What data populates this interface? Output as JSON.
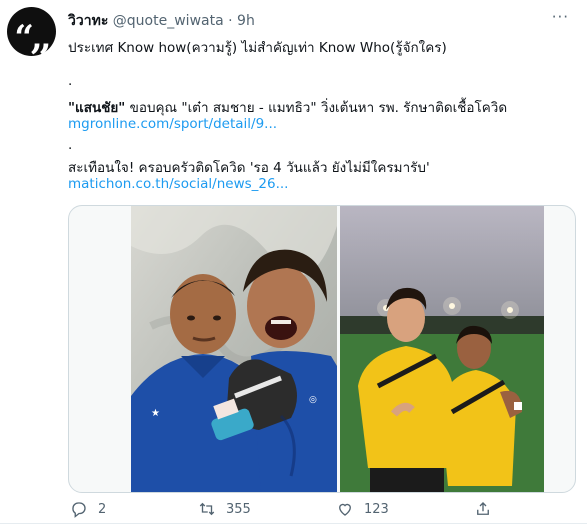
{
  "tweet": {
    "display_name": "วิวาทะ",
    "handle": "@quote_wiwata",
    "separator": "·",
    "time": "9h",
    "more_label": "···",
    "avatar_glyph": "“,,",
    "line1": "ประเทศ Know how(ความรู้) ไม่สำคัญเท่า Know Who(รู้จักใคร)",
    "dot1": ".",
    "line2_bold": "\"แสนชัย\"",
    "line2_rest": " ขอบคุณ \"เต๋า สมชาย - แมทธิว\" วิ่งเต้นหา รพ. รักษาติดเชื้อโควิด",
    "link1": "mgronline.com/sport/detail/9...",
    "dot2": ".",
    "line3": "สะเทือนใจ! ครอบครัวติดโควิด 'รอ 4 วันแล้ว ยังไม่มีใครมารับ'",
    "link2": "matichon.co.th/social/news_26..."
  },
  "actions": {
    "reply_count": "2",
    "retweet_count": "355",
    "like_count": "123"
  },
  "colors": {
    "link": "#1d9bf0",
    "muted": "#536471",
    "jersey_blue": "#1e4fa8",
    "jersey_yellow": "#f2c318"
  }
}
